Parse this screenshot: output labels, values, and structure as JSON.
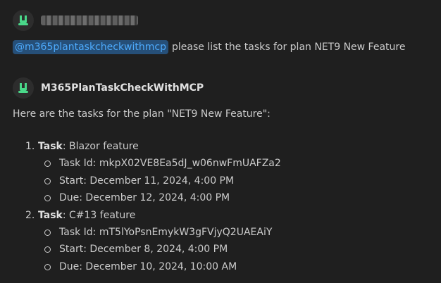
{
  "user_message": {
    "mention": "@m365plantaskcheckwithmcp",
    "text": "please list the tasks for plan NET9 New Feature"
  },
  "agent": {
    "name": "M365PlanTaskCheckWithMCP",
    "intro": "Here are the tasks for the plan \"NET9 New Feature\":",
    "tasks": [
      {
        "number": "1.",
        "label": "Task",
        "title": ": Blazor feature",
        "details": [
          "Task Id: mkpX02VE8Ea5dJ_w06nwFmUAFZa2",
          "Start: December 11, 2024, 4:00 PM",
          "Due: December 12, 2024, 4:00 PM"
        ]
      },
      {
        "number": "2.",
        "label": "Task",
        "title": ": C#13 feature",
        "details": [
          "Task Id: mT5lYoPsnEmykW3gFVjyQ2UAEAiY",
          "Start: December 8, 2024, 4:00 PM",
          "Due: December 10, 2024, 10:00 AM"
        ]
      }
    ]
  },
  "colors": {
    "background": "#1f1f1f",
    "mention_bg": "#264f78",
    "mention_text": "#4daafc",
    "avatar_icon": "#4ad88a"
  }
}
